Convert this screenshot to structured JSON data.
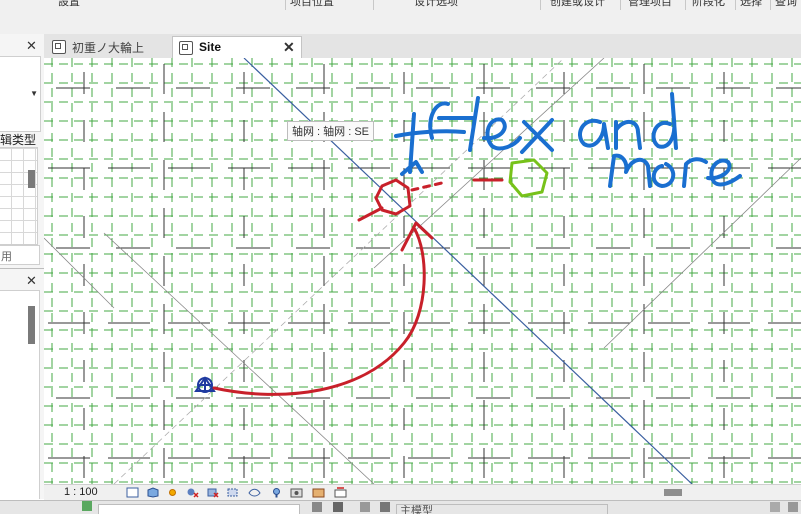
{
  "ribbon": {
    "items": [
      "設置",
      "项目位置",
      "设计选项",
      "创建或设计",
      "管理项目",
      "阶段化",
      "选择",
      "查询"
    ]
  },
  "left_panel": {
    "close_glyph": "✕",
    "type_label": "辑类型",
    "apply_label": "用"
  },
  "tabs": [
    {
      "label": "初重ノ大輪上",
      "active": false
    },
    {
      "label": "Site",
      "active": true,
      "close_glyph": "✕"
    }
  ],
  "canvas": {
    "tooltip": "轴网 : 轴网 : SE",
    "annotation": "flex and more"
  },
  "status": {
    "scale": "1 : 100"
  },
  "bottom": {
    "model_label": "主模型"
  },
  "colors": {
    "grid_green": "#44a844",
    "grid_black": "#333333",
    "diag_blue": "#3a5fa0",
    "ink_blue": "#1a6fd0",
    "ink_red": "#c8202a",
    "ink_green": "#77c21a"
  },
  "icons": [
    "sheet-icon",
    "cube-icon",
    "sun-icon",
    "shadow-icon",
    "crop-icon",
    "reveal-icon",
    "temp-hide-icon",
    "lightbulb-icon",
    "render-icon",
    "analysis-icon",
    "constraint-icon"
  ]
}
